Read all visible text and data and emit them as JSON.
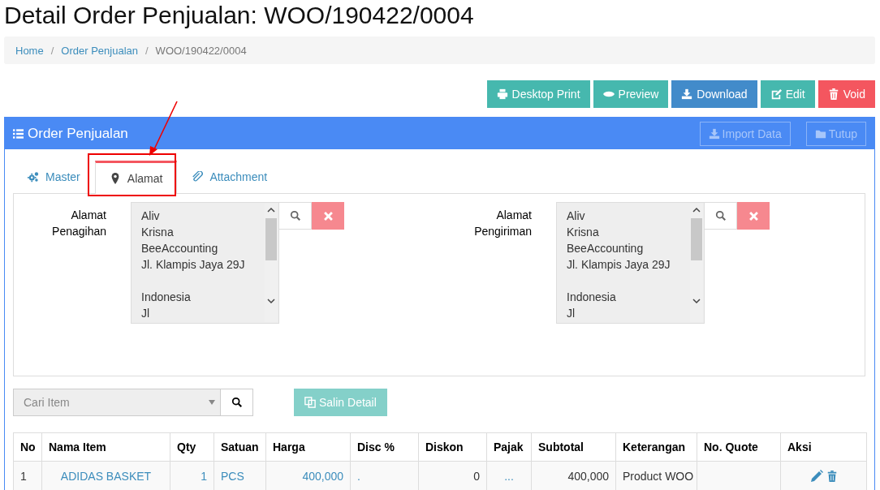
{
  "page_title": "Detail Order Penjualan: WOO/190422/0004",
  "breadcrumb": [
    {
      "label": "Home",
      "current": false
    },
    {
      "separator": "/"
    },
    {
      "label": "Order Penjualan",
      "current": false
    },
    {
      "separator": "/"
    },
    {
      "label": "WOO/190422/0004",
      "current": true
    }
  ],
  "action_buttons": [
    {
      "label": "Desktop Print",
      "kind": "print"
    },
    {
      "label": "Preview",
      "kind": "preview"
    },
    {
      "label": "Download",
      "kind": "download"
    },
    {
      "label": "Edit",
      "kind": "edit"
    },
    {
      "label": "Void",
      "kind": "void"
    }
  ],
  "panel": {
    "title": "Order Penjualan",
    "header_buttons": [
      {
        "label": "Import Data",
        "kind": "import",
        "disabled": true
      },
      {
        "label": "Tutup",
        "kind": "close",
        "disabled": true
      }
    ]
  },
  "tabs": [
    {
      "label": "Master",
      "kind": "master",
      "selected": false
    },
    {
      "label": "Alamat",
      "kind": "address",
      "selected": true
    },
    {
      "label": "Attachment",
      "kind": "attachment",
      "selected": false
    }
  ],
  "addresses": [
    {
      "label": "Alamat Penagihan",
      "paragraphs": [
        [
          "Aliv",
          "Krisna",
          "BeeAccounting",
          "Jl. Klampis Jaya 29J"
        ],
        [
          "Indonesia",
          "Jl"
        ]
      ]
    },
    {
      "label": "Alamat Pengiriman",
      "paragraphs": [
        [
          "Aliv",
          "Krisna",
          "BeeAccounting",
          "Jl. Klampis Jaya 29J"
        ],
        [
          "Indonesia",
          "Jl"
        ]
      ]
    }
  ],
  "item_search": {
    "placeholder": "Cari Item"
  },
  "copy_button": {
    "label": "Salin Detail",
    "disabled": true
  },
  "table": {
    "columns": [
      "No",
      "Nama Item",
      "Qty",
      "Satuan",
      "Harga",
      "Disc %",
      "Diskon",
      "Pajak",
      "Subtotal",
      "Keterangan",
      "No. Quote",
      "Aksi"
    ],
    "rows": [
      {
        "no": "1",
        "item": "ADIDAS BASKET",
        "qty": "1",
        "unit": "PCS",
        "price": "400,000",
        "disc_pct": ".",
        "discount": "0",
        "tax": "...",
        "subtotal": "400,000",
        "note": "Product WOO"
      }
    ]
  }
}
